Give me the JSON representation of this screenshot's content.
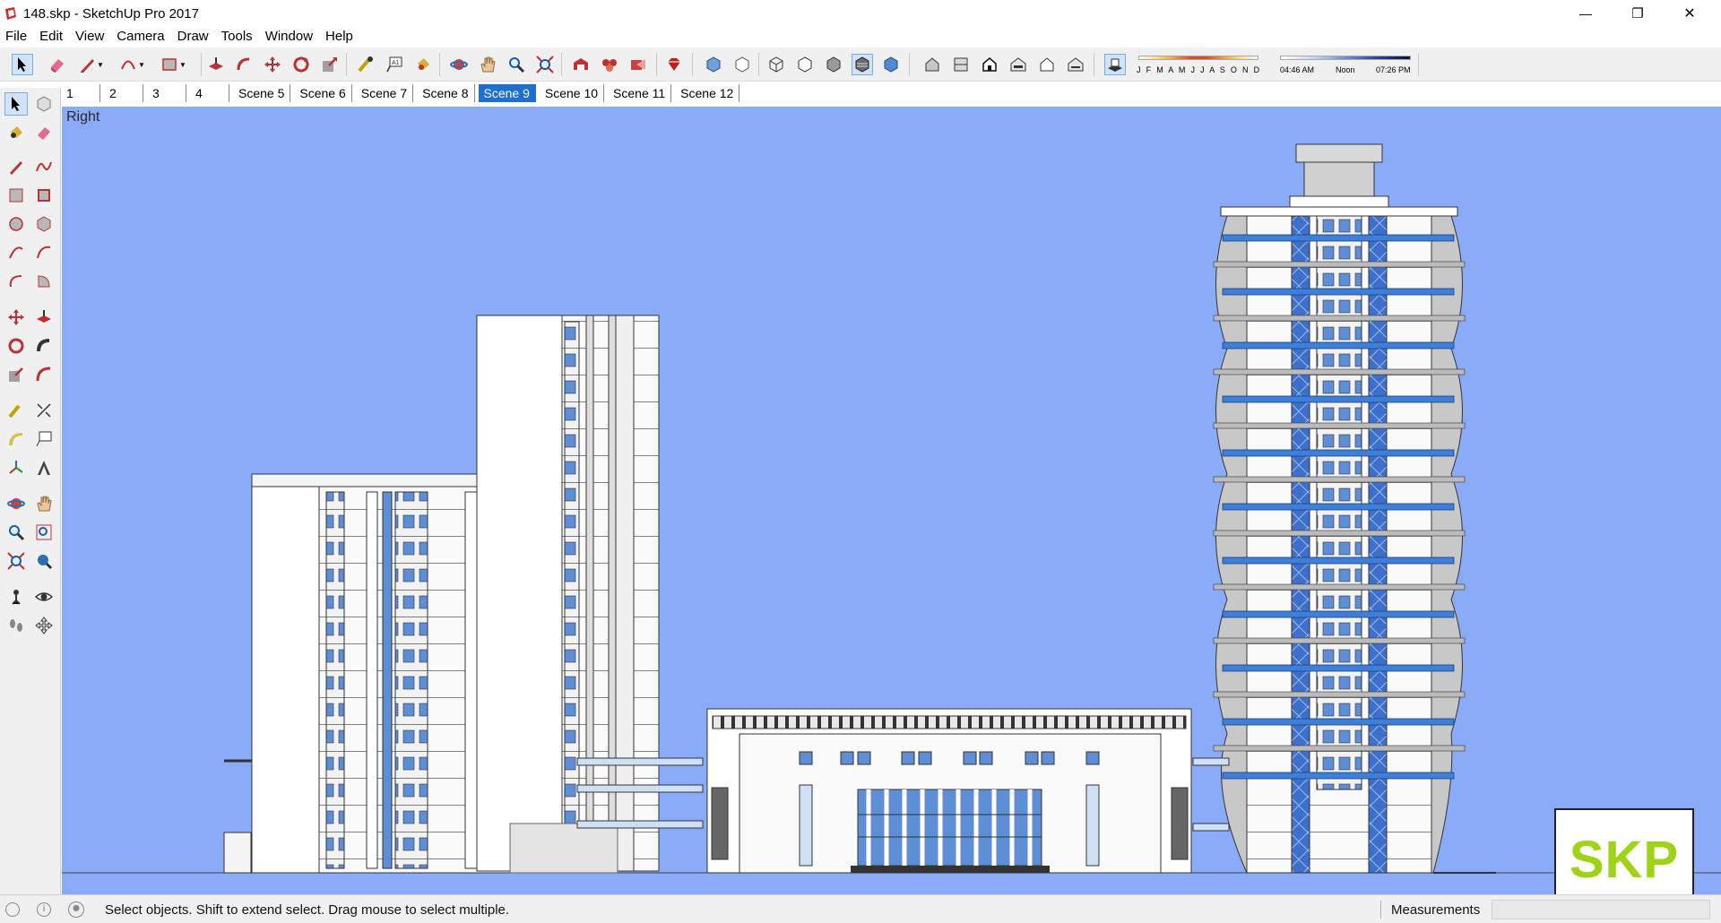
{
  "window": {
    "title": "148.skp - SketchUp Pro 2017",
    "minimize": "—",
    "restore": "❐",
    "close": "✕"
  },
  "menu": [
    "File",
    "Edit",
    "View",
    "Camera",
    "Draw",
    "Tools",
    "Window",
    "Help"
  ],
  "shadow_settings": {
    "months": "J F M A M J J A S O N D",
    "time_start": "04:46 AM",
    "time_mid": "Noon",
    "time_end": "07:26 PM"
  },
  "scenes": [
    {
      "label": "1",
      "active": false
    },
    {
      "label": "2",
      "active": false
    },
    {
      "label": "3",
      "active": false
    },
    {
      "label": "4",
      "active": false
    },
    {
      "label": "Scene 5",
      "active": false
    },
    {
      "label": "Scene 6",
      "active": false
    },
    {
      "label": "Scene 7",
      "active": false
    },
    {
      "label": "Scene 8",
      "active": false
    },
    {
      "label": "Scene 9",
      "active": true
    },
    {
      "label": "Scene 10",
      "active": false
    },
    {
      "label": "Scene 11",
      "active": false
    },
    {
      "label": "Scene 12",
      "active": false
    }
  ],
  "viewport": {
    "view_name": "Right",
    "background": "#8aabf7"
  },
  "statusbar": {
    "hint": "Select objects. Shift to extend select. Drag mouse to select multiple.",
    "measurements_label": "Measurements",
    "measurements_value": ""
  },
  "watermark": {
    "text": "SKP"
  },
  "colors": {
    "accent": "#1e6fd0",
    "sky": "#8aabf7",
    "glass": "#3d7fd9",
    "watermark_green": "#9fd317"
  }
}
